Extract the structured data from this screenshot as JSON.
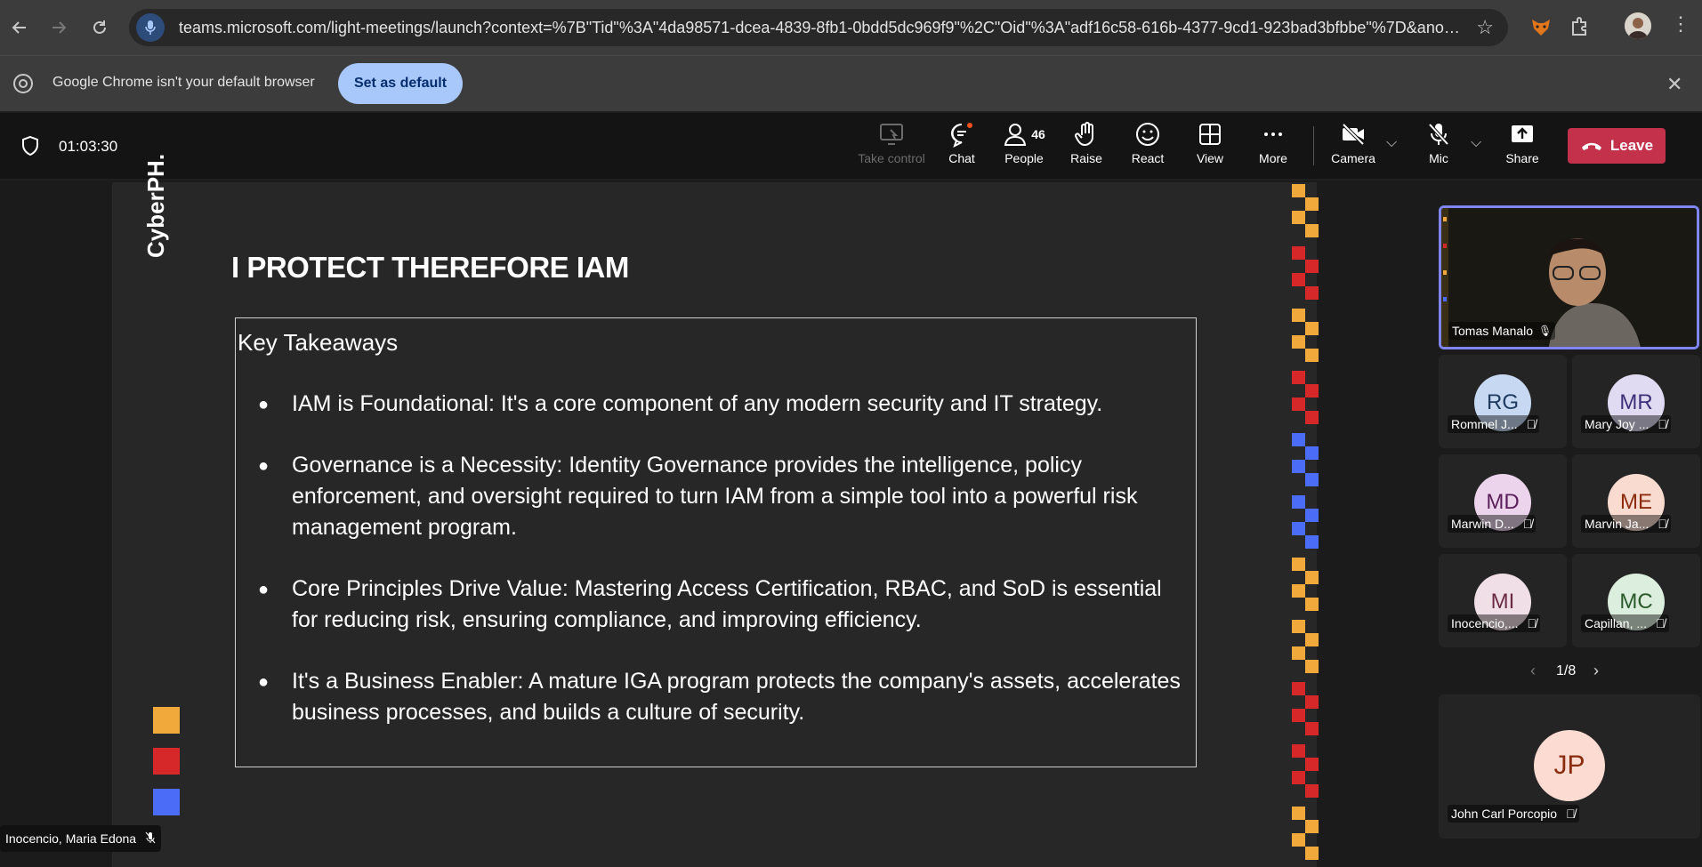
{
  "browser": {
    "url": "teams.microsoft.com/light-meetings/launch?context=%7B\"Tid\"%3A\"4da98571-dcea-4839-8fb1-0bdd5dc969f9\"%2C\"Oid\"%3A\"adf16c58-616b-4377-9cd1-923bad3bfbbe\"%7D&anon=tru...",
    "infobar_text": "Google Chrome isn't your default browser",
    "set_default_label": "Set as default"
  },
  "meeting": {
    "timer": "01:03:30",
    "toolbar": {
      "take_control": "Take control",
      "chat": "Chat",
      "people": "People",
      "people_count": "46",
      "raise": "Raise",
      "react": "React",
      "view": "View",
      "more": "More",
      "camera": "Camera",
      "mic": "Mic",
      "share": "Share",
      "leave": "Leave"
    }
  },
  "slide": {
    "brand": "CyberPH.",
    "title": "I PROTECT THEREFORE IAM",
    "box_title": "Key Takeaways",
    "bullets": [
      "IAM is Foundational: It's a core component of any modern security and IT strategy.",
      "Governance is a Necessity: Identity Governance provides the intelligence, policy enforcement, and oversight required to turn IAM from a simple tool into a powerful risk management program.",
      "Core Principles Drive Value: Mastering Access Certification, RBAC, and SoD is essential for reducing risk, ensuring compliance, and improving efficiency.",
      "It's a Business Enabler: A mature IGA program protects the company's assets, accelerates business processes, and builds a culture of security."
    ]
  },
  "presenter_label": "Inocencio, Maria Edona",
  "participants": {
    "featured": {
      "name": "Tomas Manalo"
    },
    "tiles": [
      {
        "initials": "RG",
        "name": "Rommel J..."
      },
      {
        "initials": "MR",
        "name": "Mary Joy ..."
      },
      {
        "initials": "MD",
        "name": "Marwin D..."
      },
      {
        "initials": "ME",
        "name": "Marvin Ja..."
      },
      {
        "initials": "MI",
        "name": "Inocencio,..."
      },
      {
        "initials": "MC",
        "name": "Capillan, ..."
      }
    ],
    "pager": "1/8",
    "bottom": {
      "initials": "JP",
      "name": "John Carl Porcopio"
    }
  },
  "colors": {
    "leave": "#c4314b",
    "accent_yellow": "#f2a93b",
    "accent_red": "#d62828",
    "accent_blue": "#4a6cf7",
    "featured_border": "#7f85f5"
  }
}
